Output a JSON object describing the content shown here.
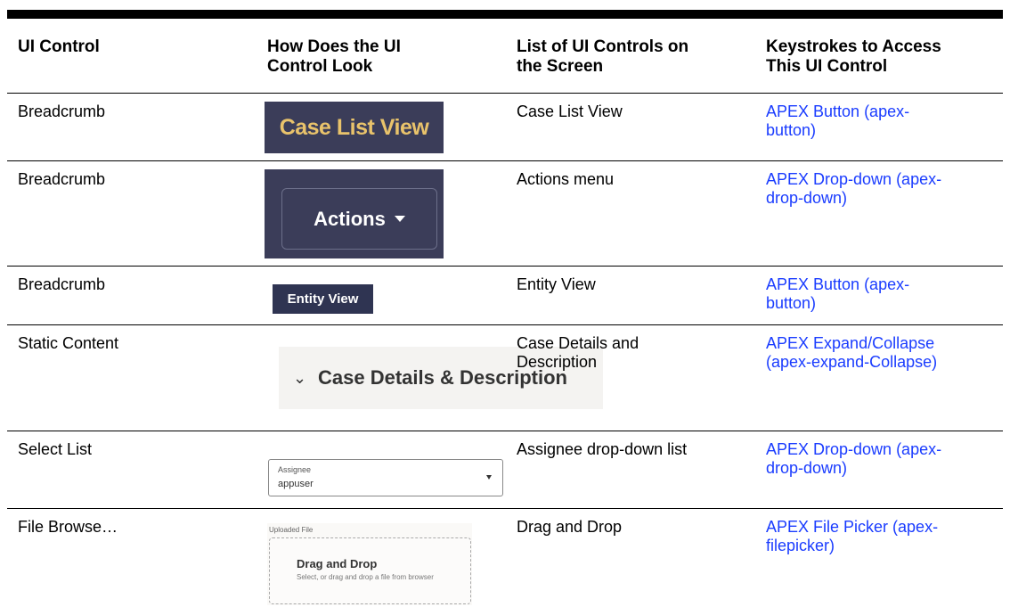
{
  "headers": [
    "UI Control",
    "How Does the UI\nControl Look",
    "List of UI Controls on\nthe Screen",
    "Keystrokes to Access\nThis UI Control"
  ],
  "rows": [
    {
      "control": "Breadcrumb",
      "screen": "Case List View",
      "keys": "APEX Button (apex-\nbutton)",
      "sample": {
        "text": "Case List View"
      }
    },
    {
      "control": "Breadcrumb",
      "screen": "Actions menu",
      "keys": "APEX Drop-down (apex-\ndrop-down)",
      "sample": {
        "text": "Actions"
      }
    },
    {
      "control": "Breadcrumb",
      "screen": "Entity View",
      "keys": "APEX Button (apex-\nbutton)",
      "sample": {
        "text": "Entity View"
      }
    },
    {
      "control": "Static Content",
      "screen": "Case Details and\nDescription",
      "keys": "APEX Expand/Collapse\n(apex-expand-Collapse)",
      "sample": {
        "text": "Case Details & Description"
      }
    },
    {
      "control": "Select List",
      "screen": "Assignee drop-down list",
      "keys": "APEX Drop-down (apex-\ndrop-down)",
      "sample": {
        "label": "Assignee",
        "value": "appuser"
      }
    },
    {
      "control": "File Browse…",
      "screen": "Drag and Drop",
      "keys": "APEX File Picker (apex-\nfilepicker)",
      "sample": {
        "label": "Uploaded File",
        "title": "Drag and Drop",
        "hint": "Select, or drag and drop a file from browser"
      }
    }
  ],
  "colors": {
    "link": "#1a3cff",
    "navbar": "#3b3d59",
    "breadcrumb_text": "#e9c36b"
  }
}
